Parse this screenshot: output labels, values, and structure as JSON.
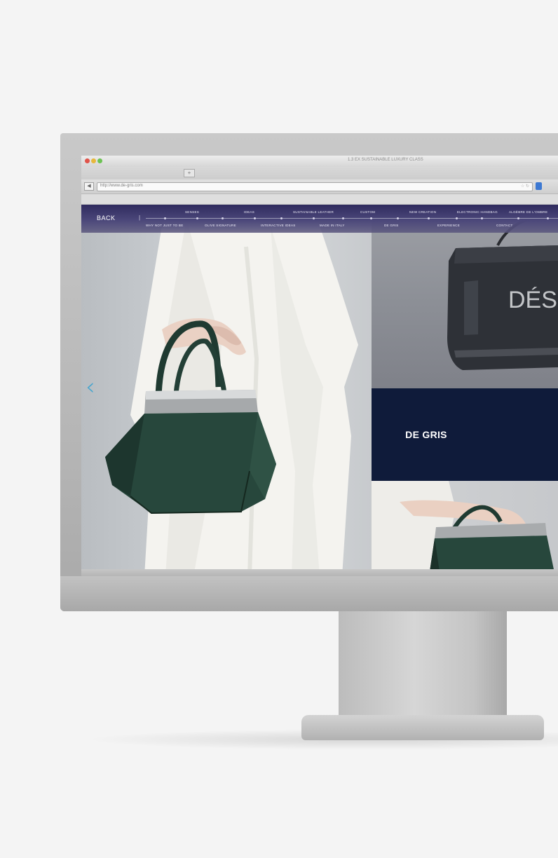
{
  "browser": {
    "window_title": "1.3 EX SUSTAINABLE LUXURY CLASS",
    "new_tab_label": "+",
    "url": "http://www.de-gris.com",
    "url_icons": "☆ ↻",
    "back_label": "◀"
  },
  "nav": {
    "back_label": "BACK",
    "separator": "|",
    "top_row": [
      "SENSES",
      "IDEAS",
      "SUSTAINABLE LEATHER",
      "CUSTOM",
      "NEW CREATION",
      "ELECTRONIC HANDBAG",
      "ALGÈBRE DE L'OMBRE"
    ],
    "bottom_row": [
      "WHY NOT JUST TO BE",
      "OLIVE SIGNATURE",
      "INTERACTIVE IDEAS",
      "MADE IN ITALY",
      "DE GRIS",
      "EXPERIENCE",
      "CONTACT"
    ]
  },
  "hero": {
    "prev_arrow": "‹",
    "brand_name": "DE GRIS",
    "bag_label": "DÉS"
  },
  "colors": {
    "nav_bg": "#3a3669",
    "brand_panel": "#0f1b3a",
    "accent_arrow": "#44a5cf",
    "bag_green": "#27473c"
  }
}
